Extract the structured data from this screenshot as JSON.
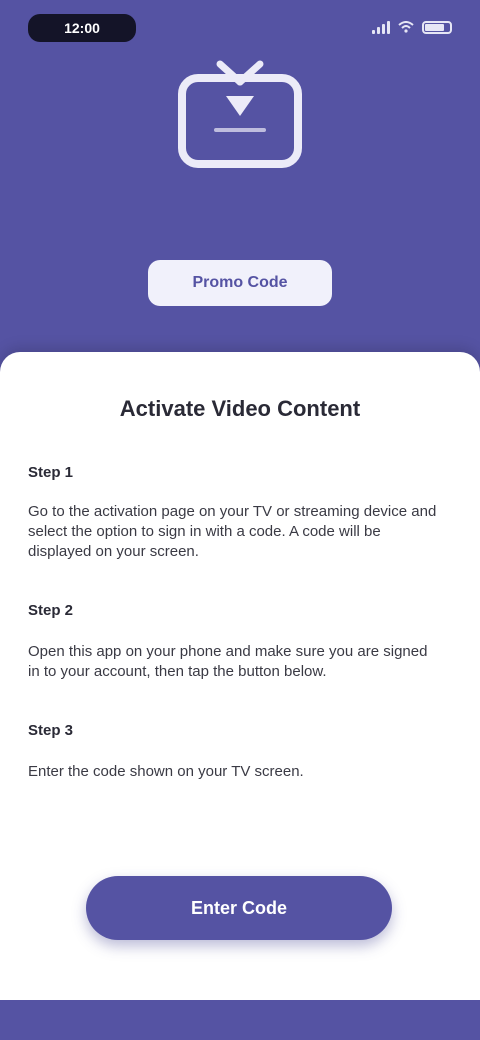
{
  "status_bar": {
    "time": "12:00",
    "icons": [
      "signal-icon",
      "wifi-icon",
      "battery-icon"
    ],
    "battery_level": 0.8
  },
  "hero": {
    "icon": "tv-icon",
    "promo_label": "Promo Code"
  },
  "instructions": {
    "title": "Activate Video Content",
    "steps": [
      {
        "label": "Step 1",
        "text": "Go to the activation page on your TV or streaming device and select the option to sign in with a code. A code will be displayed on your screen."
      },
      {
        "label": "Step 2",
        "text": "Open this app on your phone and make sure you are signed in to your account, then tap the button below."
      },
      {
        "label": "Step 3",
        "text": "Enter the code shown on your TV screen."
      }
    ],
    "cta_label": "Enter Code"
  },
  "colors": {
    "accent": "#5553a3",
    "sheet": "#ffffff",
    "text": "#2a2a36"
  }
}
